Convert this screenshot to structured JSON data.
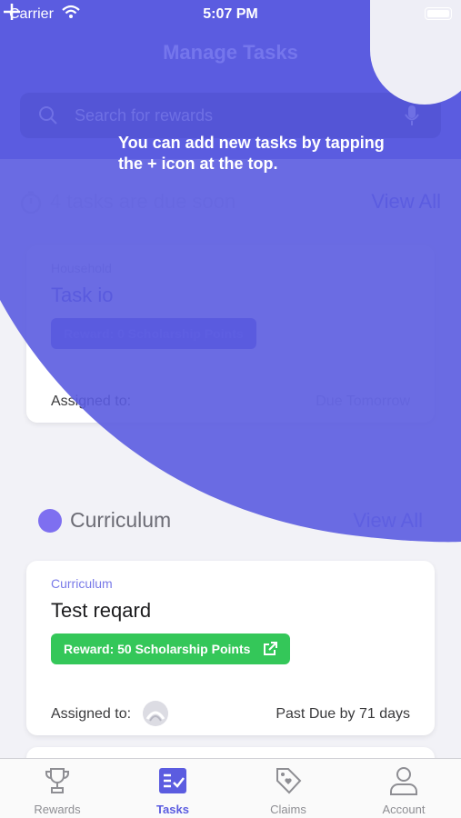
{
  "status_bar": {
    "carrier": "Carrier",
    "time": "5:07 PM"
  },
  "header": {
    "title": "Manage Tasks"
  },
  "search": {
    "placeholder": "Search for rewards"
  },
  "due_soon": {
    "text": "4 tasks are due soon",
    "view_all": "View All"
  },
  "household_card": {
    "category": "Household",
    "title": "Task io",
    "reward": "Reward: 0 Scholarship Points",
    "assigned_label": "Assigned to:",
    "due": "Due Tomorrow"
  },
  "curriculum_section": {
    "title": "Curriculum",
    "view_all": "View All"
  },
  "curriculum_card": {
    "category": "Curriculum",
    "title": "Test reqard",
    "reward": "Reward: 50 Scholarship Points",
    "assigned_label": "Assigned to:",
    "due": "Past Due by 71 days"
  },
  "coach_mark": {
    "text": "You can add new tasks by tapping the + icon at the top."
  },
  "tabbar": {
    "tabs": [
      {
        "label": "Rewards",
        "icon": "trophy-icon",
        "active": false
      },
      {
        "label": "Tasks",
        "icon": "tasks-icon",
        "active": true
      },
      {
        "label": "Claims",
        "icon": "tag-icon",
        "active": false
      },
      {
        "label": "Account",
        "icon": "person-icon",
        "active": false
      }
    ]
  },
  "colors": {
    "accent": "#5b5ce0",
    "success": "#34c759",
    "background": "#f2f2f7"
  }
}
